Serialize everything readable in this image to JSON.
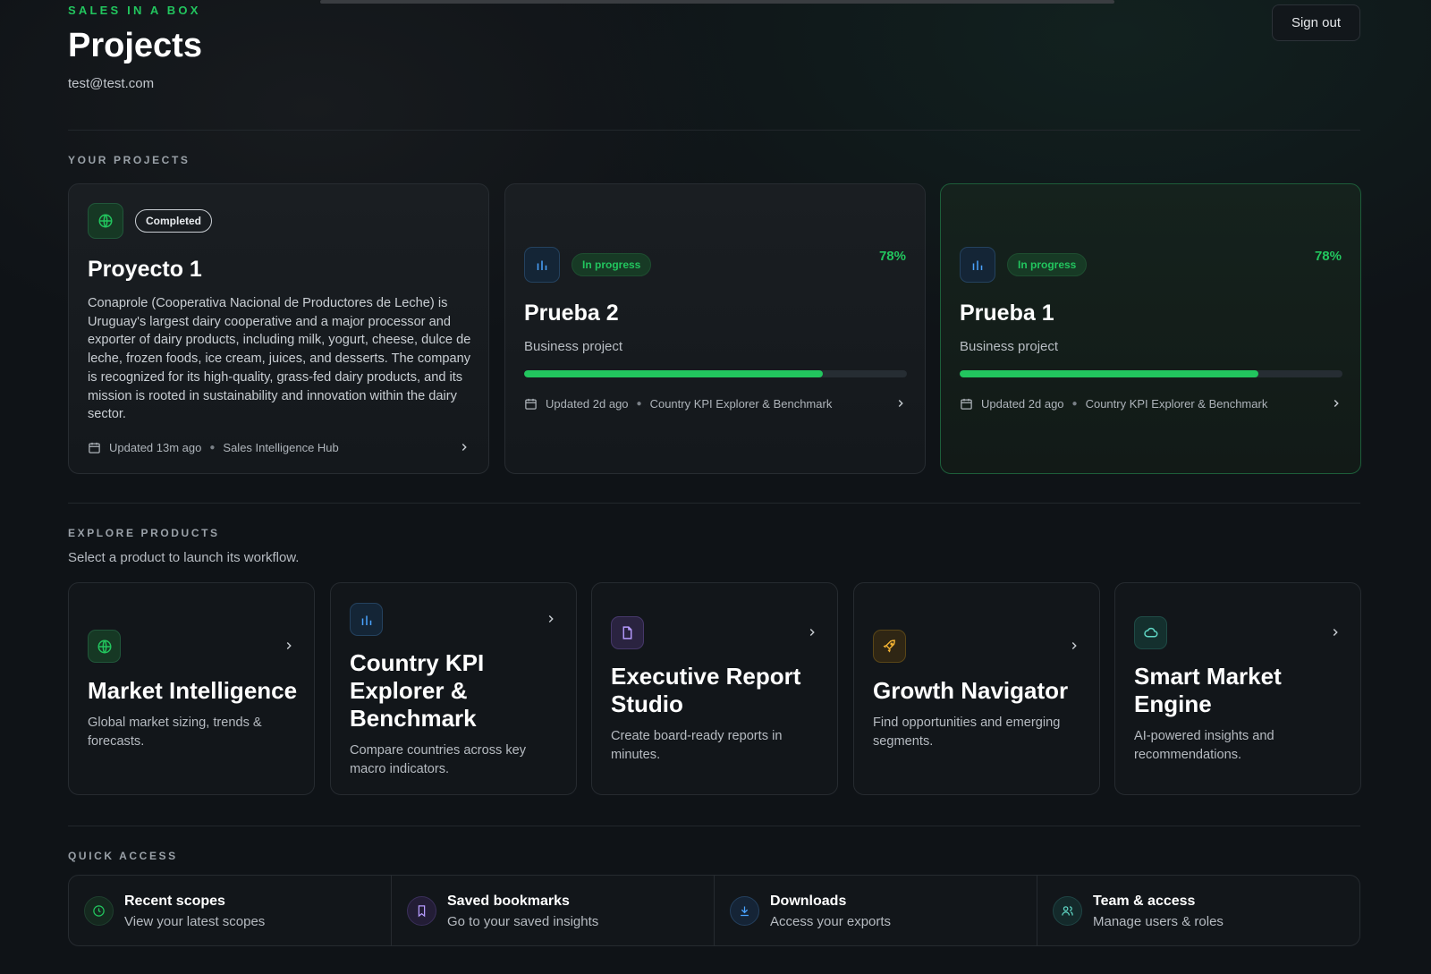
{
  "header": {
    "brand": "SALES IN A BOX",
    "title": "Projects",
    "email": "test@test.com",
    "sign_out": "Sign out"
  },
  "projects_section": {
    "label": "YOUR PROJECTS",
    "cards": [
      {
        "icon": "globe-icon",
        "status": "Completed",
        "title": "Proyecto 1",
        "description": "Conaprole (Cooperativa Nacional de Productores de Leche) is Uruguay's largest dairy cooperative and a major processor and exporter of dairy products, including milk, yogurt, cheese, dulce de leche, frozen foods, ice cream, juices, and desserts. The company is recognized for its high-quality, grass-fed dairy products, and its mission is rooted in sustainability and innovation within the dairy sector.",
        "updated": "Updated 13m ago",
        "product": "Sales Intelligence Hub"
      },
      {
        "icon": "bar-chart-icon",
        "status": "In progress",
        "percent": "78%",
        "progress": 0.78,
        "title": "Prueba 2",
        "subtitle": "Business project",
        "updated": "Updated 2d ago",
        "product": "Country KPI Explorer & Benchmark"
      },
      {
        "icon": "bar-chart-icon",
        "status": "In progress",
        "percent": "78%",
        "progress": 0.78,
        "title": "Prueba 1",
        "subtitle": "Business project",
        "updated": "Updated 2d ago",
        "product": "Country KPI Explorer & Benchmark"
      }
    ]
  },
  "explore_section": {
    "label": "EXPLORE PRODUCTS",
    "subtitle": "Select a product to launch its workflow.",
    "products": [
      {
        "icon": "globe-icon",
        "title": "Market Intelligence",
        "description": "Global market sizing, trends & forecasts."
      },
      {
        "icon": "bar-chart-icon",
        "title": "Country KPI Explorer & Benchmark",
        "description": "Compare countries across key macro indicators."
      },
      {
        "icon": "document-icon",
        "title": "Executive Report Studio",
        "description": "Create board-ready reports in minutes."
      },
      {
        "icon": "rocket-icon",
        "title": "Growth Navigator",
        "description": "Find opportunities and emerging segments."
      },
      {
        "icon": "cloud-icon",
        "title": "Smart Market Engine",
        "description": "AI-powered insights and recommendations."
      }
    ]
  },
  "quick_section": {
    "label": "QUICK ACCESS",
    "items": [
      {
        "icon": "clock-icon",
        "title": "Recent scopes",
        "subtitle": "View your latest scopes"
      },
      {
        "icon": "bookmark-icon",
        "title": "Saved bookmarks",
        "subtitle": "Go to your saved insights"
      },
      {
        "icon": "download-icon",
        "title": "Downloads",
        "subtitle": "Access your exports"
      },
      {
        "icon": "users-icon",
        "title": "Team & access",
        "subtitle": "Manage users & roles"
      }
    ]
  },
  "colors": {
    "accent": "#22c55e",
    "background": "#0f1317",
    "card": "#12161a"
  }
}
